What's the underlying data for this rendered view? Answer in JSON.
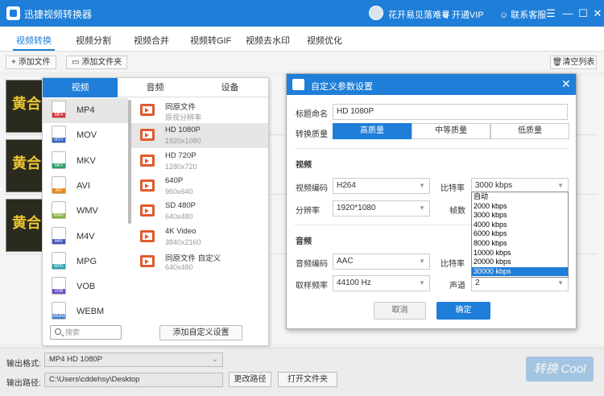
{
  "titlebar": {
    "app_title": "迅捷视频转换器",
    "user_name": "花开易见落难寻",
    "vip_label": "开通VIP",
    "service_label": "联系客服",
    "minimize": "—",
    "maximize": "☐",
    "close": "✕",
    "menu": "☰"
  },
  "nav": {
    "tabs": [
      "视频转换",
      "视频分割",
      "视频合并",
      "视频转GIF",
      "视频去水印",
      "视频优化"
    ]
  },
  "toolbar": {
    "add_file": "+ 添加文件",
    "add_folder": "添加文件夹",
    "clear_list": "清空列表"
  },
  "thumbs": [
    "黄合",
    "黄合",
    "黄合"
  ],
  "format_panel": {
    "tabs": [
      "视频",
      "音频",
      "设备"
    ],
    "containers": [
      {
        "label": "MP4",
        "color": "#d9363e"
      },
      {
        "label": "MOV",
        "color": "#2f63c6"
      },
      {
        "label": "MKV",
        "color": "#2a9e66"
      },
      {
        "label": "AVI",
        "color": "#e88a1c"
      },
      {
        "label": "WMV",
        "color": "#7fb236"
      },
      {
        "label": "M4V",
        "color": "#4257c4"
      },
      {
        "label": "MPG",
        "color": "#24a6b2"
      },
      {
        "label": "VOB",
        "color": "#6c52c7"
      },
      {
        "label": "WEBM",
        "color": "#3a7fd1"
      }
    ],
    "presets": [
      {
        "name": "同原文件",
        "desc": "原视分辨率"
      },
      {
        "name": "HD 1080P",
        "desc": "1920x1080"
      },
      {
        "name": "HD 720P",
        "desc": "1280x720"
      },
      {
        "name": "640P",
        "desc": "960x640"
      },
      {
        "name": "SD 480P",
        "desc": "640x480"
      },
      {
        "name": "4K Video",
        "desc": "3840x2160"
      },
      {
        "name": "同原文件 自定义",
        "desc": "640x480"
      }
    ],
    "search_placeholder": "搜索",
    "add_custom": "添加自定义设置"
  },
  "dialog": {
    "title": "自定义参数设置",
    "close": "✕",
    "name_label": "标题命名",
    "name_value": "HD 1080P",
    "quality_label": "转换质量",
    "quality_options": [
      "高质量",
      "中等质量",
      "低质量"
    ],
    "video_section": "视频",
    "video_codec_label": "视频编码",
    "video_codec_value": "H264",
    "bitrate_label": "比特率",
    "bitrate_value": "3000 kbps",
    "resolution_label": "分辨率",
    "resolution_value": "1920*1080",
    "fps_label": "帧数",
    "audio_section": "音频",
    "audio_codec_label": "音频编码",
    "audio_codec_value": "AAC",
    "audio_bitrate_label": "比特率",
    "samplerate_label": "取样频率",
    "samplerate_value": "44100 Hz",
    "channel_label": "声道",
    "channel_value": "2",
    "cancel": "取消",
    "ok": "确定",
    "bitrate_options": [
      "自动",
      "2000 kbps",
      "3000 kbps",
      "4000 kbps",
      "6000 kbps",
      "8000 kbps",
      "10000 kbps",
      "20000 kbps",
      "30000 kbps"
    ]
  },
  "bottom": {
    "format_label": "输出格式:",
    "format_value": "MP4  HD 1080P",
    "path_label": "输出路径:",
    "path_value": "C:\\Users\\cddehsy\\Desktop",
    "change_path": "更改路径",
    "open_folder": "打开文件夹",
    "watermark": "转换 Cool"
  }
}
